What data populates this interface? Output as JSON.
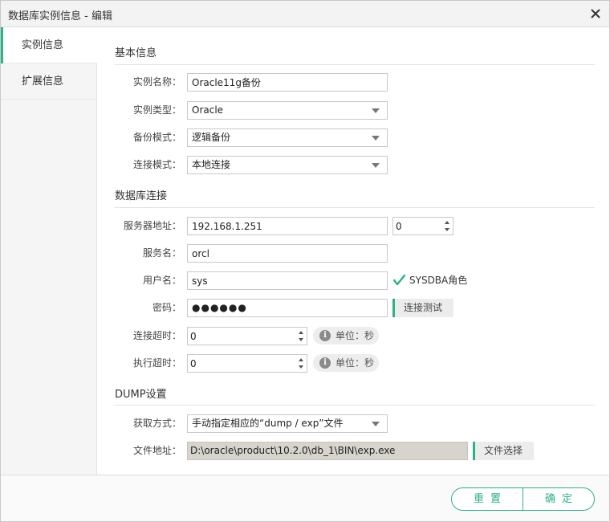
{
  "window": {
    "title": "数据库实例信息 - 编辑"
  },
  "sidebar": {
    "items": [
      {
        "label": "实例信息"
      },
      {
        "label": "扩展信息"
      }
    ]
  },
  "basic": {
    "section_title": "基本信息",
    "instance_name": {
      "label": "实例名称：",
      "value": "Oracle11g备份"
    },
    "instance_type": {
      "label": "实例类型：",
      "value": "Oracle"
    },
    "backup_mode": {
      "label": "备份模式：",
      "value": "逻辑备份"
    },
    "connect_mode": {
      "label": "连接模式：",
      "value": "本地连接"
    }
  },
  "db": {
    "section_title": "数据库连接",
    "server": {
      "label": "服务器地址：",
      "value": "192.168.1.251",
      "port": "0"
    },
    "service": {
      "label": "服务名：",
      "value": "orcl"
    },
    "user": {
      "label": "用户名：",
      "value": "sys",
      "sysdba_label": "SYSDBA角色",
      "sysdba_checked": true
    },
    "password": {
      "label": "密码：",
      "value": "●●●●●●",
      "test_button": "连接测试"
    },
    "connect_timeout": {
      "label": "连接超时：",
      "value": "0",
      "unit": "单位：秒"
    },
    "exec_timeout": {
      "label": "执行超时：",
      "value": "0",
      "unit": "单位：秒"
    }
  },
  "dump": {
    "section_title": "DUMP设置",
    "acquire": {
      "label": "获取方式：",
      "value": "手动指定相应的“dump / exp”文件"
    },
    "file": {
      "label": "文件地址：",
      "value": "D:\\oracle\\product\\10.2.0\\db_1\\BIN\\exp.exe",
      "select_button": "文件选择"
    }
  },
  "footer": {
    "reset": "重置",
    "confirm": "确定"
  },
  "colors": {
    "accent": "#2db286"
  },
  "icons": {
    "close": "close-icon",
    "info": "info-icon",
    "check": "check-icon",
    "dropdown": "chevron-down-icon"
  }
}
